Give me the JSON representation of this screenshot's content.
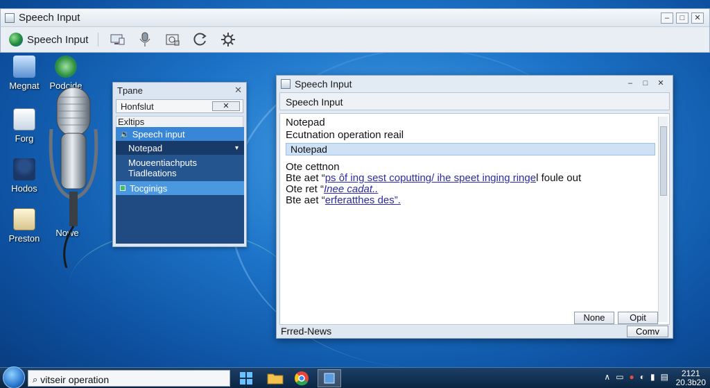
{
  "top_window": {
    "title": "Speech Input",
    "speech_button_label": "Speech Input",
    "controls": [
      "–",
      "□",
      "✕"
    ],
    "toolbar_icons": [
      "monitor-icon",
      "microphone-icon",
      "camera-icon",
      "refresh-icon",
      "gear-icon"
    ]
  },
  "desktop_icons": [
    {
      "label": "Megnat",
      "icon": "monitor-icon"
    },
    {
      "label": "Podcide",
      "icon": "globe-icon"
    },
    {
      "label": "Forg",
      "icon": "document-icon"
    },
    {
      "label": "Hodos",
      "icon": "user-icon"
    },
    {
      "label": "Preston",
      "icon": "clipboard-icon"
    },
    {
      "label": "Nowe",
      "icon": "microphone-icon"
    }
  ],
  "tpane": {
    "title": "Tpane",
    "close": "✕",
    "input_value": "Honfslut",
    "input_button": "✕",
    "label": "Exltips",
    "items": [
      {
        "label": "Speech input"
      },
      {
        "label": "Notepad"
      },
      {
        "label": "Moueentiachputs\nTiadleations"
      },
      {
        "label": "Tocginigs"
      }
    ]
  },
  "main_window": {
    "title": "Speech Input",
    "menu_label": "Speech Input",
    "line1": "Notepad",
    "line2": "Ecutnation operation reail",
    "selected_line": "Notepad",
    "text_lines": [
      {
        "prefix": "Ote cettnon",
        "link": "",
        "suffix": ""
      },
      {
        "prefix": "Bte aet “",
        "link": "ps ôf ing sest coputting/ ihe speet inging ringe",
        "suffix": "l foule out"
      },
      {
        "prefix": "Ote ret “",
        "link": "Inee cadat..",
        "suffix": ""
      },
      {
        "prefix": "Bte aet “",
        "link": "erferatthes des”.",
        "suffix": ""
      }
    ],
    "buttons": [
      "None",
      "Opit"
    ],
    "status_text": "Frred-News",
    "status_button": "Comv"
  },
  "taskbar": {
    "search_text": "vitseir operation",
    "clock_line1": "2121",
    "clock_line2": "20.3b20",
    "apps": [
      "windows-icon",
      "folder-icon",
      "chrome-icon",
      "app-icon"
    ]
  },
  "colors": {
    "desktop": "#1c73c8",
    "taskbar": "#0b2644",
    "selection": "#3a86d6"
  }
}
